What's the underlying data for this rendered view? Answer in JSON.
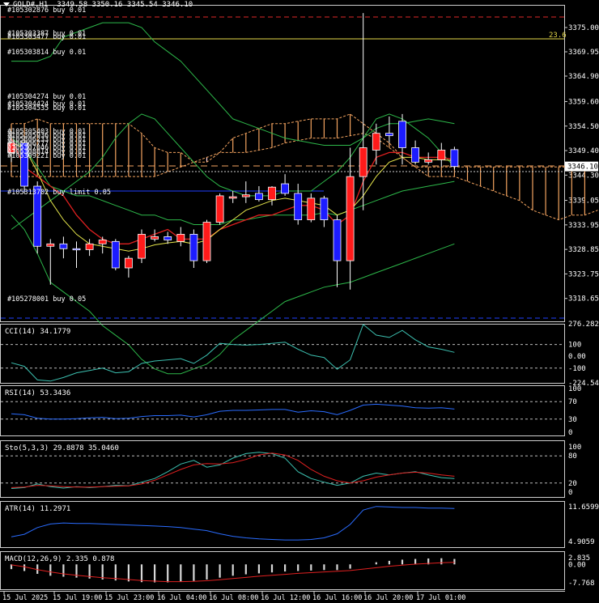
{
  "header": {
    "symbol": "GOLD#,H1",
    "ohlc": "3349.58 3350.16 3345.54 3346.10"
  },
  "colors": {
    "background": "#000000",
    "bull_fill": "#ff1a1a",
    "bear_fill": "#1c1cff",
    "candle_outline": "#ffffff",
    "kumo_orange": "#f4a460",
    "kumo_pink": "#ffd8e4",
    "tenkan_red": "#e02020",
    "bb_green": "#2db84a",
    "ma_yellow": "#e6e64b",
    "teal_line": "#3cc0b0",
    "atr_blue": "#2a6cff",
    "order_line_red": "#e02828",
    "order_line_yellow": "#e6d84a",
    "order_line_blue": "#2040ff",
    "dash_orange": "#f3a35f"
  },
  "main_panel": {
    "price_labels": [
      "3375.00",
      "3369.95",
      "3364.90",
      "3359.60",
      "3354.50",
      "3349.40",
      "3344.30",
      "3339.05",
      "3333.95",
      "3328.85",
      "3323.75",
      "3318.65"
    ],
    "current_price": "3346.10",
    "fib_label": "23.6",
    "orders": [
      {
        "label": "#105302876 buy 0.01"
      },
      {
        "label": "#105303387 buy 0.01"
      },
      {
        "label": "#105303477 buy 0.01"
      },
      {
        "label": "#105303814 buy 0.01"
      },
      {
        "label": "#105304274 buy 0.01"
      },
      {
        "label": "#105304424 buy 0.01"
      },
      {
        "label": "#105304535 buy 0.01"
      },
      {
        "label": "#105305403 buy 0.01"
      },
      {
        "label": "#105305936 buy 0.01"
      },
      {
        "label": "#105306233 buy 0.01"
      },
      {
        "label": "#105306777 buy 0.01"
      },
      {
        "label": "#105307046 buy 0.01"
      },
      {
        "label": "#105308814 buy 0.01"
      },
      {
        "label": "#105309221 buy 0.01"
      },
      {
        "label": "#105313702 buy limit 0.05"
      },
      {
        "label": "#105278001 buy 0.05"
      }
    ]
  },
  "indicators": {
    "cci": {
      "label": "CCI(14) 34.1779",
      "levels": [
        "276.2829",
        "100",
        "0.00",
        "-100",
        "-224.5498"
      ]
    },
    "rsi": {
      "label": "RSI(14) 53.3436",
      "levels": [
        "100",
        "70",
        "30",
        "0"
      ]
    },
    "sto": {
      "label": "Sto(5,3,3) 29.8878 35.0460",
      "levels": [
        "100",
        "80",
        "20",
        "0"
      ]
    },
    "atr": {
      "label": "ATR(14) 11.2971",
      "levels": [
        "11.6599",
        "4.9059"
      ]
    },
    "macd": {
      "label": "MACD(12,26,9) 2.335 0.878",
      "levels": [
        "2.835",
        "0.00",
        "-7.768"
      ]
    }
  },
  "time_axis": [
    "15 Jul 2025",
    "15 Jul 19:00",
    "15 Jul 23:00",
    "16 Jul 04:00",
    "16 Jul 08:00",
    "16 Jul 12:00",
    "16 Jul 16:00",
    "16 Jul 20:00",
    "17 Jul 01:00"
  ],
  "series": {
    "candles": [
      [
        3349.0,
        3353.5,
        3347.0,
        3351.0
      ],
      [
        3351.0,
        3352.5,
        3340.5,
        3342.0
      ],
      [
        3342.0,
        3343.0,
        3328.0,
        3329.5
      ],
      [
        3329.5,
        3331.0,
        3321.5,
        3330.0
      ],
      [
        3330.0,
        3331.5,
        3327.0,
        3329.0
      ],
      [
        3329.0,
        3330.5,
        3325.0,
        3328.8
      ],
      [
        3328.8,
        3331.0,
        3327.5,
        3330.0
      ],
      [
        3330.0,
        3331.5,
        3328.0,
        3330.8
      ],
      [
        3330.5,
        3331.0,
        3324.5,
        3325.0
      ],
      [
        3325.0,
        3327.5,
        3323.0,
        3327.0
      ],
      [
        3327.0,
        3333.0,
        3326.0,
        3332.0
      ],
      [
        3331.0,
        3333.0,
        3330.5,
        3331.5
      ],
      [
        3331.5,
        3332.5,
        3330.0,
        3330.8
      ],
      [
        3330.5,
        3333.5,
        3329.5,
        3332.0
      ],
      [
        3332.0,
        3333.0,
        3325.0,
        3326.5
      ],
      [
        3326.5,
        3335.0,
        3326.0,
        3334.5
      ],
      [
        3334.5,
        3340.5,
        3334.0,
        3340.0
      ],
      [
        3339.5,
        3341.0,
        3338.5,
        3339.8
      ],
      [
        3339.8,
        3343.0,
        3338.5,
        3340.2
      ],
      [
        3340.5,
        3342.0,
        3338.8,
        3339.2
      ],
      [
        3339.2,
        3342.0,
        3338.0,
        3341.8
      ],
      [
        3342.5,
        3344.5,
        3340.0,
        3340.5
      ],
      [
        3340.5,
        3342.5,
        3334.0,
        3335.0
      ],
      [
        3335.0,
        3340.5,
        3334.5,
        3339.5
      ],
      [
        3339.5,
        3340.0,
        3333.5,
        3335.0
      ],
      [
        3335.0,
        3336.0,
        3321.0,
        3326.5
      ],
      [
        3326.5,
        3350.0,
        3320.5,
        3344.0
      ],
      [
        3344.0,
        3378.0,
        3337.0,
        3350.0
      ],
      [
        3349.5,
        3355.0,
        3346.5,
        3353.0
      ],
      [
        3353.0,
        3356.5,
        3351.0,
        3352.5
      ],
      [
        3355.5,
        3357.0,
        3346.5,
        3350.0
      ],
      [
        3350.0,
        3351.5,
        3346.5,
        3347.0
      ],
      [
        3347.0,
        3349.0,
        3346.5,
        3347.5
      ],
      [
        3347.5,
        3351.0,
        3346.0,
        3349.5
      ],
      [
        3349.6,
        3350.2,
        3345.5,
        3346.1
      ]
    ],
    "ma_yellow": [
      3351,
      3350,
      3345,
      3339,
      3335,
      3332,
      3330,
      3329.5,
      3329,
      3328.5,
      3329,
      3329.8,
      3330.2,
      3330.5,
      3330,
      3330.8,
      3333,
      3335,
      3337,
      3338,
      3339,
      3339.5,
      3339,
      3338.5,
      3338,
      3336,
      3337,
      3340,
      3344,
      3347,
      3348,
      3348,
      3347.5,
      3347.5,
      3347.3
    ],
    "tenkan_red": [
      3352,
      3346,
      3344,
      3342,
      3340,
      3336,
      3333,
      3331,
      3330,
      3330,
      3331,
      3332,
      3333,
      3331,
      3331,
      3331,
      3333,
      3334,
      3335,
      3336,
      3336,
      3337,
      3338,
      3338,
      3337,
      3334,
      3336,
      3343,
      3348,
      3349,
      3349,
      3348,
      3348,
      3348,
      3347.5
    ],
    "bb_upper": [
      3368,
      3368,
      3368,
      3369,
      3373,
      3374,
      3375,
      3376,
      3376,
      3376,
      3375,
      3372,
      3370,
      3368,
      3365,
      3362,
      3359,
      3356,
      3355,
      3354,
      3353,
      3352,
      3351.5,
      3351,
      3350.5,
      3350.5,
      3350.5,
      3352,
      3354,
      3355,
      3355,
      3355.5,
      3356,
      3355.5,
      3355
    ],
    "bb_mid": [
      3352,
      3350,
      3346,
      3342,
      3341,
      3340,
      3340,
      3339,
      3338,
      3337,
      3336,
      3336,
      3335,
      3335,
      3334,
      3334,
      3334,
      3335,
      3335,
      3335.5,
      3336,
      3336,
      3336,
      3336,
      3336.5,
      3336,
      3337,
      3338,
      3339,
      3340,
      3341,
      3341.5,
      3342,
      3342.5,
      3343
    ],
    "bb_lower": [
      3336,
      3333,
      3328,
      3322,
      3320,
      3318,
      3316,
      3313,
      3311,
      3309,
      3306,
      3304,
      3303,
      3303,
      3304,
      3305,
      3307,
      3310,
      3312,
      3314,
      3316,
      3318,
      3319,
      3320,
      3321,
      3321.5,
      3322,
      3323,
      3324,
      3325,
      3326,
      3327,
      3328,
      3329,
      3330
    ],
    "kumo_a": [
      3355,
      3355,
      3356,
      3355,
      3355,
      3355,
      3355,
      3355,
      3355,
      3355,
      3353,
      3350,
      3349,
      3349,
      3347,
      3347,
      3349,
      3352,
      3353,
      3354,
      3355,
      3355,
      3355.5,
      3356,
      3356,
      3356,
      3357,
      3355,
      3353,
      3351,
      3348,
      3346,
      3346,
      3346,
      3346,
      3346,
      3346,
      3346,
      3346,
      3346,
      3346,
      3346,
      3346,
      3346,
      3346
    ],
    "kumo_b": [
      3344,
      3344,
      3344,
      3344,
      3344,
      3344,
      3344,
      3344,
      3344,
      3344,
      3344,
      3344,
      3345,
      3346,
      3347,
      3348,
      3349,
      3349,
      3349,
      3349.5,
      3350,
      3351,
      3351.5,
      3352,
      3352,
      3352,
      3352.5,
      3353,
      3352,
      3350,
      3348,
      3346,
      3344,
      3344,
      3344,
      3343,
      3342,
      3341,
      3340,
      3339,
      3337,
      3336,
      3335,
      3336,
      3336,
      3337
    ],
    "teal_line": [
      3333,
      3335,
      3337,
      3339,
      3341,
      3343,
      3345,
      3348,
      3352,
      3355,
      3357,
      3356,
      3353,
      3350,
      3347,
      3344,
      3342,
      3341,
      3340,
      3340,
      3340,
      3341,
      3341,
      3341,
      3343,
      3345,
      3348,
      3352,
      3356,
      3357,
      3356,
      3354,
      3352,
      3349,
      3346
    ],
    "cci": [
      -55,
      -85,
      -200,
      -210,
      -180,
      -140,
      -120,
      -100,
      -140,
      -130,
      -60,
      -40,
      -30,
      -20,
      -60,
      10,
      110,
      100,
      95,
      100,
      110,
      120,
      60,
      10,
      -10,
      -110,
      -30,
      270,
      180,
      160,
      220,
      140,
      80,
      60,
      34
    ],
    "rsi": [
      42,
      40,
      32,
      30,
      30,
      31,
      33,
      34,
      31,
      32,
      36,
      38,
      38,
      39,
      35,
      40,
      48,
      50,
      50,
      51,
      52,
      52,
      46,
      49,
      47,
      40,
      50,
      62,
      64,
      62,
      60,
      56,
      55,
      56,
      53
    ],
    "sto_k": [
      8,
      10,
      18,
      12,
      9,
      12,
      10,
      12,
      15,
      14,
      22,
      30,
      45,
      62,
      70,
      55,
      60,
      75,
      85,
      88,
      85,
      75,
      45,
      30,
      22,
      15,
      20,
      35,
      42,
      38,
      42,
      45,
      38,
      32,
      30
    ],
    "sto_d": [
      10,
      11,
      15,
      14,
      12,
      11,
      11,
      12,
      13,
      14,
      18,
      26,
      38,
      50,
      60,
      63,
      62,
      65,
      72,
      82,
      86,
      82,
      70,
      50,
      35,
      25,
      20,
      25,
      33,
      38,
      42,
      44,
      42,
      38,
      35
    ],
    "atr": [
      5.8,
      6.3,
      7.6,
      8.3,
      8.5,
      8.4,
      8.4,
      8.3,
      8.2,
      8.1,
      8.0,
      7.9,
      7.8,
      7.6,
      7.3,
      7.0,
      6.4,
      5.9,
      5.6,
      5.4,
      5.3,
      5.2,
      5.2,
      5.3,
      5.6,
      6.4,
      8.2,
      11.0,
      11.7,
      11.6,
      11.5,
      11.5,
      11.4,
      11.4,
      11.3
    ],
    "macd_hist": [
      -2.0,
      -2.8,
      -4.0,
      -4.8,
      -5.2,
      -5.6,
      -6.0,
      -6.4,
      -6.8,
      -7.2,
      -7.5,
      -7.6,
      -7.6,
      -7.4,
      -7.0,
      -6.4,
      -5.6,
      -4.8,
      -4.2,
      -3.8,
      -3.4,
      -3.0,
      -2.8,
      -2.6,
      -2.4,
      -2.4,
      -1.8,
      0.0,
      0.9,
      1.5,
      2.0,
      2.3,
      2.5,
      2.6,
      2.3
    ],
    "macd_signal": [
      -0.2,
      -1.0,
      -2.2,
      -3.2,
      -4.0,
      -4.6,
      -5.1,
      -5.6,
      -6.0,
      -6.4,
      -6.8,
      -7.1,
      -7.3,
      -7.3,
      -7.2,
      -6.9,
      -6.5,
      -6.0,
      -5.5,
      -5.0,
      -4.6,
      -4.2,
      -3.8,
      -3.5,
      -3.2,
      -2.9,
      -2.6,
      -2.0,
      -1.4,
      -0.8,
      -0.3,
      0.1,
      0.4,
      0.7,
      0.9
    ]
  }
}
